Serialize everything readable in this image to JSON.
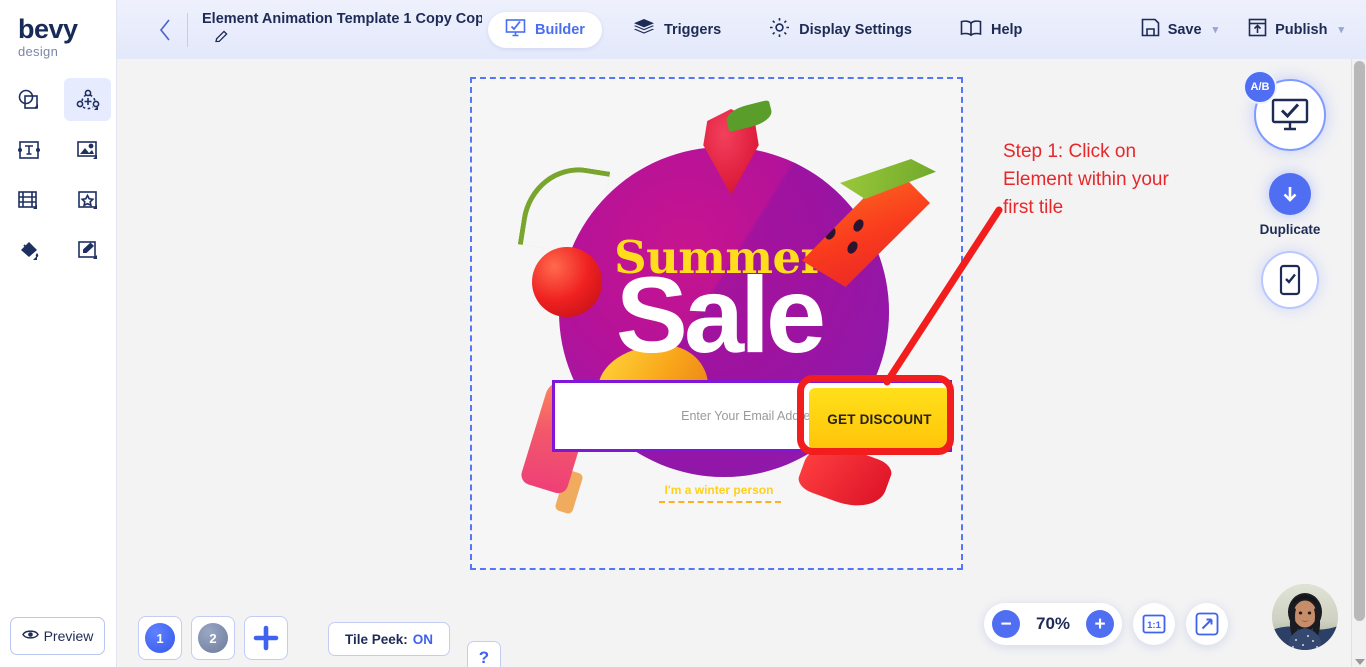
{
  "brand": {
    "name": "bevy",
    "tagline": "design"
  },
  "sidebar": {
    "tools": [
      {
        "id": "shapes",
        "icon": "shapes-icon",
        "selected": false
      },
      {
        "id": "element",
        "icon": "element-node-icon",
        "selected": true
      },
      {
        "id": "text",
        "icon": "text-icon",
        "selected": false
      },
      {
        "id": "image",
        "icon": "image-icon",
        "selected": false
      },
      {
        "id": "video",
        "icon": "video-icon",
        "selected": false
      },
      {
        "id": "shape-star",
        "icon": "star-icon",
        "selected": false
      },
      {
        "id": "fill",
        "icon": "paint-bucket-icon",
        "selected": false
      },
      {
        "id": "draw",
        "icon": "pencil-edit-icon",
        "selected": false
      }
    ],
    "preview_label": "Preview",
    "preview_icon": "eye-icon"
  },
  "header": {
    "back_icon": "chevron-left-icon",
    "document_title": "Element Animation Template 1 Copy Cop…",
    "edit_icon": "pencil-icon",
    "tabs": [
      {
        "label": "Builder",
        "icon": "builder-monitor-icon",
        "active": true
      },
      {
        "label": "Triggers",
        "icon": "layers-icon",
        "active": false
      },
      {
        "label": "Display Settings",
        "icon": "gear-icon",
        "active": false
      },
      {
        "label": "Help",
        "icon": "book-icon",
        "active": false
      }
    ],
    "actions": [
      {
        "label": "Save",
        "icon": "save-floppy-icon",
        "caret": "▾"
      },
      {
        "label": "Publish",
        "icon": "publish-upload-icon",
        "caret": "▾"
      }
    ]
  },
  "canvas": {
    "banner": {
      "heading_top": "Summer",
      "heading_main": "Sale",
      "email_placeholder": "Enter Your Email Address",
      "email_value": "",
      "cta_label": "GET DISCOUNT",
      "decline_label": "I'm a winter person"
    },
    "annotation": {
      "text": "Step 1: Click on Element within your first tile",
      "color": "#e8272b"
    },
    "highlight_color": "#f21d1d",
    "selection_border_color": "#5577f5"
  },
  "right_panel": {
    "ab_badge": "A/B",
    "desktop_icon": "desktop-check-icon",
    "duplicate_label": "Duplicate",
    "duplicate_icon": "arrow-down-icon",
    "mobile_icon": "mobile-check-icon"
  },
  "bottom": {
    "tiles": [
      {
        "label": "1",
        "active": true
      },
      {
        "label": "2",
        "active": false
      }
    ],
    "add_tile_icon": "plus-icon",
    "tile_peek_label": "Tile Peek:",
    "tile_peek_value": "ON",
    "help_label": "?",
    "zoom": {
      "minus": "−",
      "value": "70%",
      "plus": "+",
      "actual_size_label": "1:1",
      "fit_icon": "fit-screen-icon"
    },
    "avatar_name": "user-avatar"
  }
}
